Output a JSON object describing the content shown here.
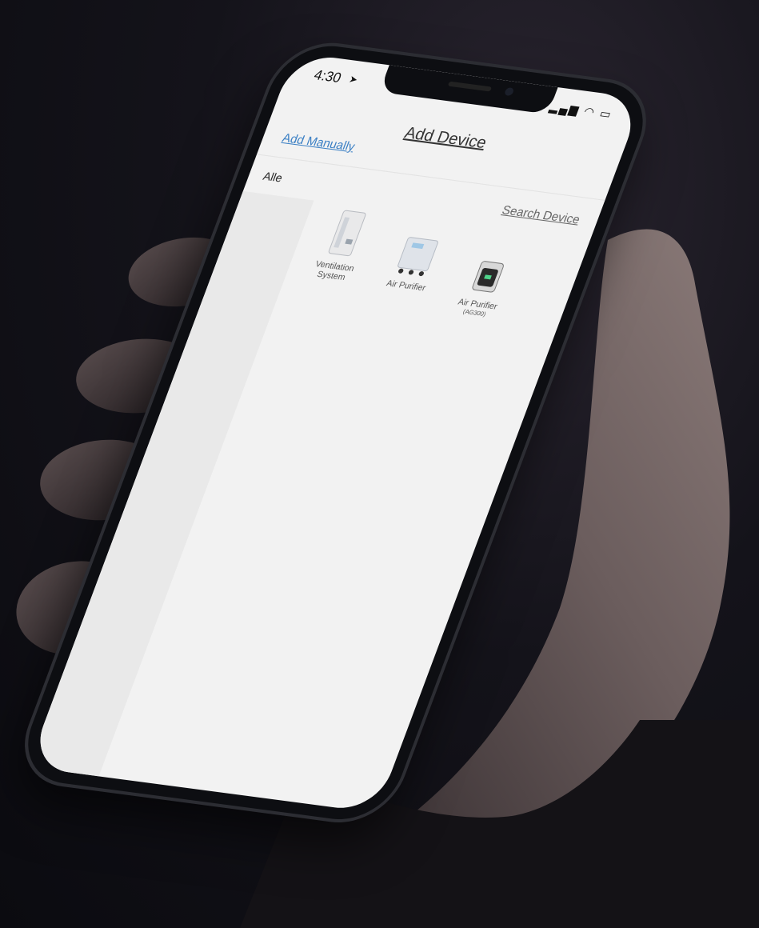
{
  "status_bar": {
    "time": "4:30",
    "signal": "▂▄▆",
    "wifi": "◠",
    "battery": "▭"
  },
  "header": {
    "title": "Add Device",
    "add_manually": "Add Manually"
  },
  "filter": {
    "category": "Alle",
    "search_link": "Search Device"
  },
  "devices": [
    {
      "label_line1": "Ventilation",
      "label_line2": "System"
    },
    {
      "label_line1": "Air Purifier",
      "label_line2": ""
    },
    {
      "label_line1": "Air Purifier",
      "label_line2": "(AG300)"
    }
  ]
}
